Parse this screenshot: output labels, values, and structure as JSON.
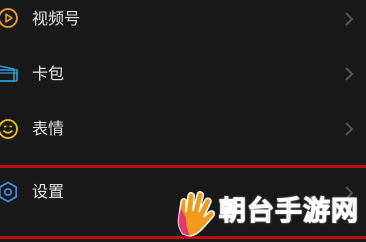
{
  "menu": {
    "items": [
      {
        "label": "视频号",
        "icon": "channels-icon"
      },
      {
        "label": "卡包",
        "icon": "card-wallet-icon"
      },
      {
        "label": "表情",
        "icon": "sticker-smile-icon"
      },
      {
        "label": "设置",
        "icon": "settings-gear-icon",
        "highlighted": true
      }
    ],
    "chevron_icon": "chevron-right-icon"
  },
  "watermark": {
    "text": "朝台手游网",
    "logo_icon": "hand-logo"
  },
  "colors": {
    "background": "#191919",
    "text": "#e6e6e6",
    "chevron": "#5a5a5a",
    "highlight_border": "#c40d10",
    "channels_accent": "#f0a030",
    "cards_accent": "#2a9dd8",
    "stickers_accent": "#f0c020",
    "settings_accent": "#3a8ee0",
    "watermark_pink": "#e1277c",
    "watermark_orange": "#f29a1e"
  }
}
